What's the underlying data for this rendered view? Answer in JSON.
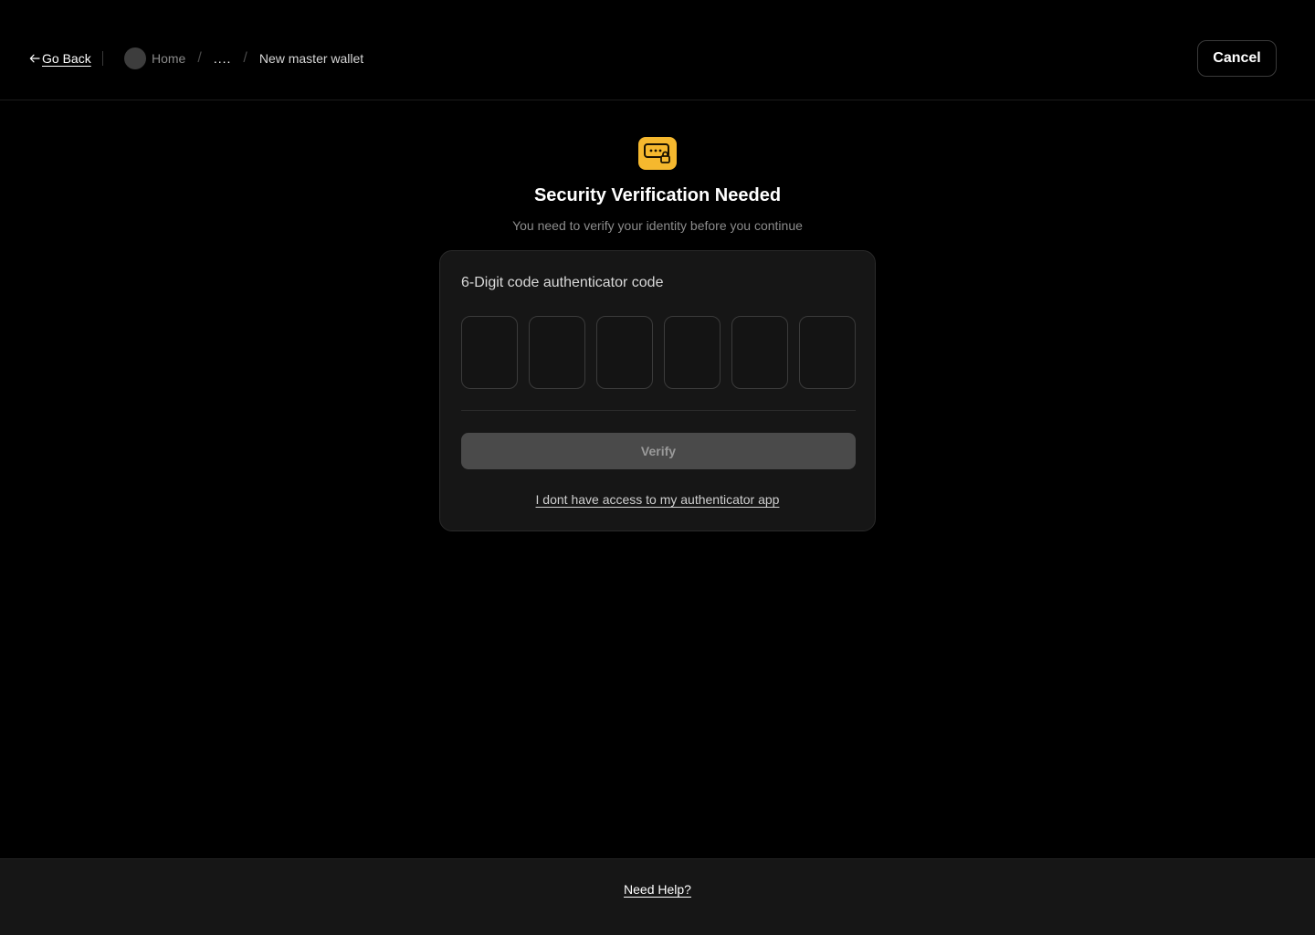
{
  "header": {
    "go_back_label": "Go Back",
    "breadcrumb": {
      "home": "Home",
      "separator": "/",
      "ellipsis": "....",
      "current": "New master wallet"
    },
    "cancel_label": "Cancel"
  },
  "hero": {
    "icon": "password-lock-icon",
    "icon_color": "#f5b82e",
    "title": "Security Verification Needed",
    "subtitle": "You need to verify your identity before you continue"
  },
  "card": {
    "label": "6-Digit code authenticator code",
    "code_digits": [
      "",
      "",
      "",
      "",
      "",
      ""
    ],
    "verify_label": "Verify",
    "no_access_label": "I dont have access to my authenticator app"
  },
  "footer": {
    "help_label": "Need Help?"
  }
}
